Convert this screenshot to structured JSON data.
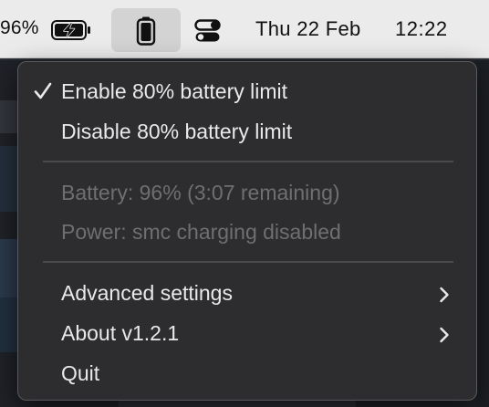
{
  "menubar": {
    "battery_percent": "96%",
    "battery_icon": "battery-charging-icon",
    "app_icon": "battery-icon",
    "control_center_icon": "control-center-icon",
    "date": "Thu 22 Feb",
    "time": "12:22"
  },
  "menu": {
    "items": [
      {
        "label": "Enable 80% battery limit",
        "checked": true,
        "enabled": true
      },
      {
        "label": "Disable 80% battery limit",
        "checked": false,
        "enabled": true
      },
      {
        "label": "Battery: 96% (3:07 remaining)",
        "enabled": false
      },
      {
        "label": "Power: smc charging disabled",
        "enabled": false
      },
      {
        "label": "Advanced settings",
        "submenu": true,
        "enabled": true
      },
      {
        "label": "About v1.2.1",
        "submenu": true,
        "enabled": true
      },
      {
        "label": "Quit",
        "enabled": true
      }
    ]
  },
  "colors": {
    "menubar_bg": "#ebebeb",
    "menu_bg": "#2d2d2f",
    "menu_text": "#e9e9e9",
    "menu_text_disabled": "#6f6f71"
  }
}
